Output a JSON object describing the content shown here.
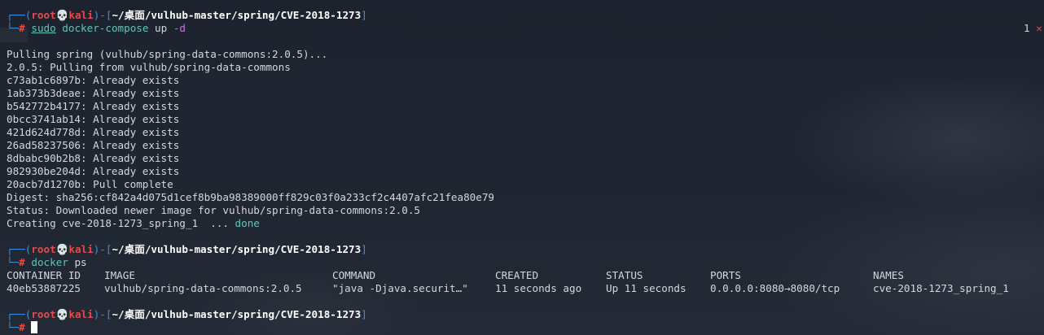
{
  "prompt": {
    "user": "root",
    "skull": "💀",
    "host": "kali",
    "path": "~/桌面/vulhub-master/spring/CVE-2018-1273",
    "hash": "#",
    "frame_top_open": "┌──(",
    "frame_close_open": ")-[",
    "frame_close": "]",
    "frame_bottom": "└─"
  },
  "cmd1": {
    "sudo": "sudo",
    "program": "docker-compose",
    "arg": "up",
    "opt": "-d"
  },
  "right_status": {
    "count": "1",
    "icon": "✕"
  },
  "output_lines": [
    "Pulling spring (vulhub/spring-data-commons:2.0.5)...",
    "2.0.5: Pulling from vulhub/spring-data-commons",
    "c73ab1c6897b: Already exists",
    "1ab373b3deae: Already exists",
    "b542772b4177: Already exists",
    "0bcc3741ab14: Already exists",
    "421d624d778d: Already exists",
    "26ad58237506: Already exists",
    "8dbabc90b2b8: Already exists",
    "982930be204d: Already exists",
    "20acb7d1270b: Pull complete",
    "Digest: sha256:cf842a4d075d1cef8b9ba98389000ff829c03f0a233cf2c4407afc21fea80e79",
    "Status: Downloaded newer image for vulhub/spring-data-commons:2.0.5"
  ],
  "creating": {
    "text": "Creating cve-2018-1273_spring_1  ... ",
    "status": "done"
  },
  "cmd2": {
    "program": "docker",
    "arg": "ps"
  },
  "ps_table": {
    "headers": [
      "CONTAINER ID",
      "IMAGE",
      "COMMAND",
      "CREATED",
      "STATUS",
      "PORTS",
      "NAMES"
    ],
    "row": [
      "40eb53887225",
      "vulhub/spring-data-commons:2.0.5",
      "\"java -Djava.securit…\"",
      "11 seconds ago",
      "Up 11 seconds",
      "0.0.0.0:8080→8080/tcp",
      "cve-2018-1273_spring_1"
    ]
  }
}
